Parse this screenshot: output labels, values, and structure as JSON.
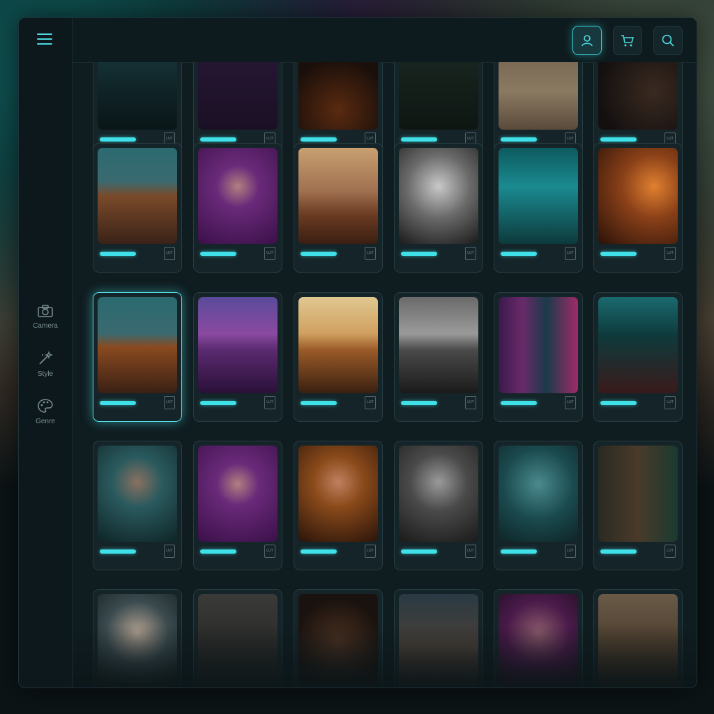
{
  "sidebar": {
    "items": [
      {
        "label": "Camera",
        "icon": "camera-icon"
      },
      {
        "label": "Style",
        "icon": "magic-wand-icon"
      },
      {
        "label": "Genre",
        "icon": "palette-icon"
      }
    ]
  },
  "topbar": {
    "buttons": [
      {
        "icon": "user-icon",
        "active": true
      },
      {
        "icon": "cart-icon",
        "active": false
      },
      {
        "icon": "search-icon",
        "active": false
      }
    ]
  },
  "lut_badge": "LUT",
  "colors": {
    "accent": "#3fe0e8",
    "panel": "#0f1c20",
    "card": "#152428"
  },
  "rows": [
    {
      "cards": [
        {
          "scene": "dark teal portrait"
        },
        {
          "scene": "purple portrait"
        },
        {
          "scene": "dark warm scene"
        },
        {
          "scene": "dark forest"
        },
        {
          "scene": "figure on desert road"
        },
        {
          "scene": "dark car interior"
        }
      ]
    },
    {
      "cards": [
        {
          "scene": "teal desert buttes"
        },
        {
          "scene": "purple man portrait"
        },
        {
          "scene": "warm desert butte"
        },
        {
          "scene": "black and white man portrait"
        },
        {
          "scene": "teal neon corridor figure"
        },
        {
          "scene": "orange room silhouette"
        }
      ]
    },
    {
      "cards": [
        {
          "scene": "teal desert dusk",
          "selected": true
        },
        {
          "scene": "purple desert dusk"
        },
        {
          "scene": "golden desert dusk"
        },
        {
          "scene": "monochrome desert"
        },
        {
          "scene": "neon city street"
        },
        {
          "scene": "astronaut in teal corridor"
        }
      ]
    },
    {
      "cards": [
        {
          "scene": "teal man portrait"
        },
        {
          "scene": "purple man portrait"
        },
        {
          "scene": "orange man portrait"
        },
        {
          "scene": "grey man portrait"
        },
        {
          "scene": "foggy teal silhouette"
        },
        {
          "scene": "man in car"
        }
      ]
    },
    {
      "cards": [
        {
          "scene": "woman portrait"
        },
        {
          "scene": "dark silhouette"
        },
        {
          "scene": "dark bokeh portrait"
        },
        {
          "scene": "desert figure"
        },
        {
          "scene": "neon woman portrait"
        },
        {
          "scene": "desert figure warm"
        }
      ]
    }
  ]
}
